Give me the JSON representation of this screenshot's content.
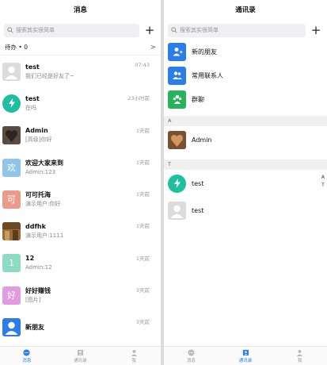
{
  "left": {
    "title": "消息",
    "search_placeholder": "搜索其实很简单",
    "plus": "+",
    "pending": {
      "label": "待办 • 0",
      "chevron": ">"
    },
    "conversations": [
      {
        "name": "test",
        "msg": "我们已经是好友了~",
        "time": "07:43",
        "avatar": "user-placeholder-icon"
      },
      {
        "name": "test",
        "msg": "在吗",
        "time": "23小时前",
        "avatar": "lightning-icon"
      },
      {
        "name": "Admin",
        "msg": "[高级]你好",
        "time": "1天前",
        "avatar": "photo-avatar"
      },
      {
        "name": "欢迎大家来到",
        "msg": "Admin:123",
        "time": "1天前",
        "avatar_text": "欢",
        "color": "#8fc5ea"
      },
      {
        "name": "可可托海",
        "msg": "演示用户:你好",
        "time": "1天前",
        "avatar_text": "可",
        "color": "#eb9b8c"
      },
      {
        "name": "ddfhk",
        "msg": "演示用户:1111",
        "time": "1天前",
        "avatar": "photo-avatar"
      },
      {
        "name": "12",
        "msg": "Admin:12",
        "time": "1天前",
        "avatar_text": "1",
        "color": "#8ddbc3"
      },
      {
        "name": "好好赚钱",
        "msg": "[图片]",
        "time": "3天前",
        "avatar_text": "好",
        "color": "#e39be0"
      },
      {
        "name": "新朋友",
        "msg": "",
        "time": "3天前",
        "avatar": "user-placeholder-icon",
        "color": "#2b7de9"
      }
    ]
  },
  "right": {
    "title": "通讯录",
    "search_placeholder": "搜索其实很简单",
    "plus": "+",
    "entries": [
      {
        "label": "新的朋友",
        "color": "#2b7de9",
        "icon": "add-user-icon"
      },
      {
        "label": "常用联系人",
        "color": "#2b7de9",
        "icon": "contacts-icon"
      },
      {
        "label": "群聊",
        "color": "#27b35b",
        "icon": "group-icon"
      }
    ],
    "sections": [
      {
        "letter": "A",
        "contacts": [
          {
            "name": "Admin",
            "avatar": "photo-avatar"
          }
        ]
      },
      {
        "letter": "T",
        "contacts": [
          {
            "name": "test",
            "avatar": "lightning-icon"
          },
          {
            "name": "test",
            "avatar": "user-placeholder-icon"
          }
        ]
      }
    ],
    "index_letters": [
      "A",
      "T"
    ]
  },
  "tabs": [
    {
      "label": "消息",
      "icon": "chat-icon"
    },
    {
      "label": "通讯录",
      "icon": "contacts-book-icon"
    },
    {
      "label": "我",
      "icon": "profile-icon"
    }
  ],
  "colors": {
    "accent": "#2b7de9",
    "green": "#27b35b",
    "teal": "#1dbf9e"
  }
}
